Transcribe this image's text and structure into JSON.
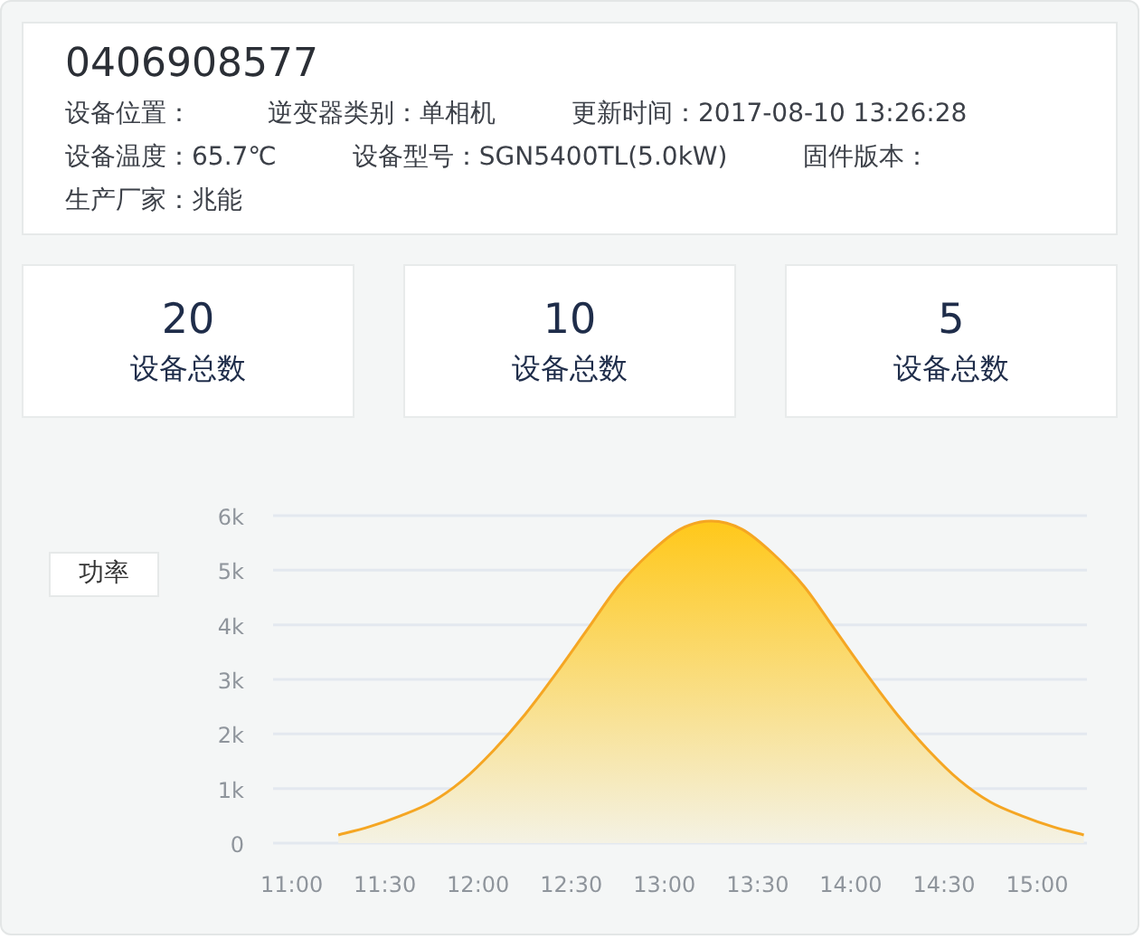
{
  "device": {
    "serial": "0406908577",
    "info_rows": [
      [
        "设备位置：",
        "逆变器类别：单相机",
        "更新时间：2017-08-10 13:26:28"
      ],
      [
        "设备温度：65.7℃",
        "设备型号：SGN5400TL(5.0kW)",
        "固件版本："
      ],
      [
        "生产厂家：兆能"
      ]
    ]
  },
  "stats": [
    {
      "value": "20",
      "label": "设备总数"
    },
    {
      "value": "10",
      "label": "设备总数"
    },
    {
      "value": "5",
      "label": "设备总数"
    }
  ],
  "chart": {
    "chart_data": {
      "type": "area",
      "grid": true,
      "xlim": [
        654,
        916
      ],
      "x": [
        675,
        685,
        695,
        705,
        715,
        725,
        735,
        745,
        755,
        765,
        775,
        785,
        795,
        805,
        815,
        825,
        835,
        845,
        855,
        865,
        875,
        885,
        895,
        905,
        915
      ],
      "series": [
        {
          "name": "功率",
          "color": "#f5a623",
          "values": [
            150,
            300,
            500,
            750,
            1150,
            1700,
            2350,
            3100,
            3900,
            4700,
            5300,
            5750,
            5900,
            5750,
            5300,
            4700,
            3900,
            3100,
            2350,
            1700,
            1150,
            750,
            500,
            300,
            150
          ]
        }
      ],
      "ylim": [
        0,
        6000
      ],
      "yticks": [
        {
          "value": 0,
          "label": "0"
        },
        {
          "value": 1000,
          "label": "1k"
        },
        {
          "value": 2000,
          "label": "2k"
        },
        {
          "value": 3000,
          "label": "3k"
        },
        {
          "value": 4000,
          "label": "4k"
        },
        {
          "value": 5000,
          "label": "5k"
        },
        {
          "value": 6000,
          "label": "6k"
        }
      ],
      "xticks": [
        {
          "value": 660,
          "label": "11:00"
        },
        {
          "value": 690,
          "label": "11:30"
        },
        {
          "value": 720,
          "label": "12:00"
        },
        {
          "value": 750,
          "label": "12:30"
        },
        {
          "value": 780,
          "label": "13:00"
        },
        {
          "value": 810,
          "label": "13:30"
        },
        {
          "value": 840,
          "label": "14:00"
        },
        {
          "value": 870,
          "label": "14:30"
        },
        {
          "value": 900,
          "label": "15:00"
        }
      ]
    }
  }
}
